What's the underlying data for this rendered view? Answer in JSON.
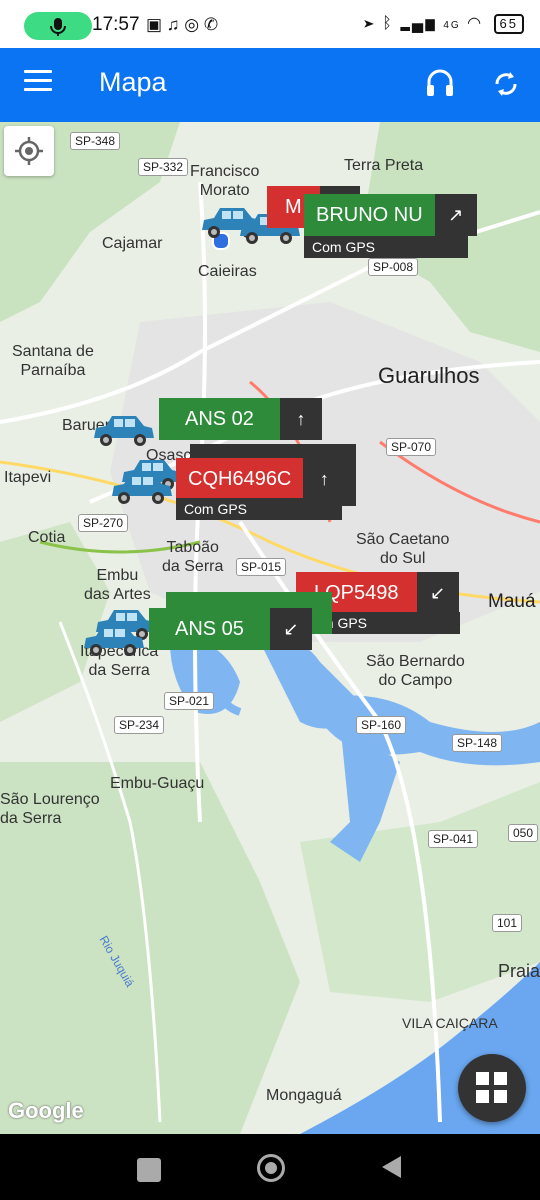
{
  "status_bar": {
    "time": "17:57",
    "mic_icon": "mic-icon",
    "notification_icons": [
      "nfc-icon",
      "headset-icon",
      "whatsapp-icon",
      "phone-icon"
    ],
    "network": "4G",
    "battery": "65"
  },
  "app_bar": {
    "title": "Mapa",
    "menu_icon": "menu-icon",
    "headset_icon": "headset-icon",
    "refresh_icon": "sync-icon",
    "color": "#0b74f2"
  },
  "map": {
    "places": [
      {
        "name": "Francisco\nMorato"
      },
      {
        "name": "Terra Preta"
      },
      {
        "name": "Cajamar"
      },
      {
        "name": "Caieiras"
      },
      {
        "name": "Santana de\nParnaíba"
      },
      {
        "name": "Guarulhos"
      },
      {
        "name": "Barueri"
      },
      {
        "name": "Itapevi"
      },
      {
        "name": "Osasco"
      },
      {
        "name": "Cotia"
      },
      {
        "name": "Taboão\nda Serra"
      },
      {
        "name": "São Caetano\ndo Sul"
      },
      {
        "name": "Embu\ndas Artes"
      },
      {
        "name": "Mauá"
      },
      {
        "name": "Itapecerica\nda Serra"
      },
      {
        "name": "São Bernardo\ndo Campo"
      },
      {
        "name": "Embu-Guaçu"
      },
      {
        "name": "São Lourenço\nda Serra"
      },
      {
        "name": "Rio Juquiá"
      },
      {
        "name": "Praia"
      },
      {
        "name": "VILA CAIÇARA"
      },
      {
        "name": "Mongaguá"
      }
    ],
    "roads": [
      "SP-348",
      "SP-332",
      "SP-008",
      "SP-070",
      "SP-270",
      "SP-015",
      "SP-021",
      "SP-234",
      "SP-160",
      "SP-148",
      "SP-041",
      "050",
      "101"
    ],
    "attribution": "Google"
  },
  "vehicles": [
    {
      "plate": "BRUNO NU",
      "status": "green",
      "heading": "↗",
      "sub": "Com GPS"
    },
    {
      "plate": "M",
      "status": "red",
      "heading": "",
      "sub": ""
    },
    {
      "plate": "ANS 02",
      "status": "green",
      "heading": "↑",
      "sub": ""
    },
    {
      "plate": "CQH6496C",
      "status": "red",
      "heading": "↑",
      "sub": "Com GPS"
    },
    {
      "plate": "LQP5498",
      "status": "red",
      "heading": "↙",
      "sub": "Com GPS"
    },
    {
      "plate": "ANS 05",
      "status": "green",
      "heading": "↙",
      "sub": ""
    }
  ],
  "colors": {
    "online": "#2e8b3a",
    "offline": "#d4302f",
    "label_dark": "#333333"
  },
  "fab": {
    "icon": "grid-icon"
  },
  "locate": {
    "icon": "locate-icon"
  }
}
